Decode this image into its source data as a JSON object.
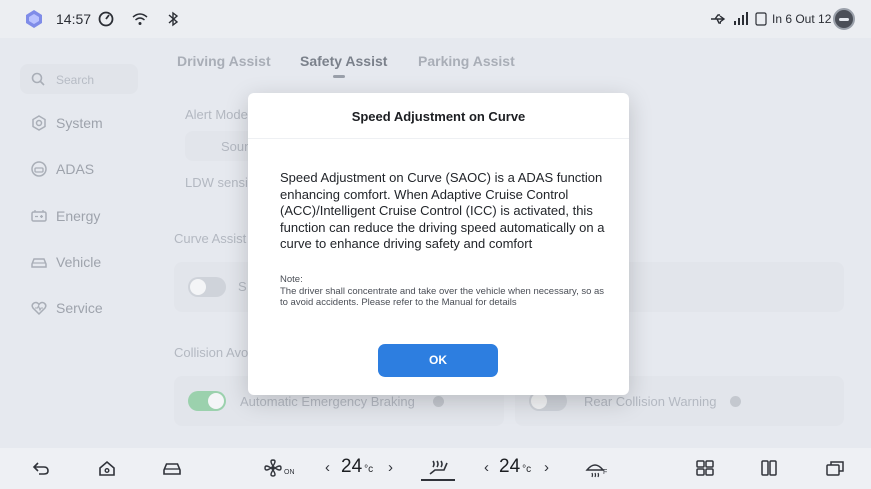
{
  "status_bar": {
    "time": "14:57",
    "right_text": "In 6 Out 12",
    "icons": [
      "app-logo-icon",
      "drive-mode-icon",
      "wifi-icon",
      "bluetooth-icon",
      "usb-icon",
      "cellular-signal-icon",
      "sim-icon",
      "avatar-icon"
    ]
  },
  "sidebar": {
    "search_placeholder": "Search",
    "items": [
      {
        "label": "System",
        "icon": "gear-icon"
      },
      {
        "label": "ADAS",
        "icon": "car-radar-icon"
      },
      {
        "label": "Energy",
        "icon": "battery-icon"
      },
      {
        "label": "Vehicle",
        "icon": "vehicle-icon"
      },
      {
        "label": "Service",
        "icon": "heart-icon"
      }
    ]
  },
  "tabs": [
    {
      "label": "Driving Assist",
      "active": false
    },
    {
      "label": "Safety Assist",
      "active": true
    },
    {
      "label": "Parking Assist",
      "active": false
    }
  ],
  "background": {
    "alert_mode_label": "Alert Mode",
    "sound_label": "Sound",
    "ldw_label": "LDW sensitivity",
    "curve_assist_label": "Curve Assist",
    "curve_item_label": "S",
    "collision_label": "Collision Avoidance",
    "aeb_label": "Automatic Emergency Braking",
    "rcw_label": "Rear Collision Warning"
  },
  "dialog": {
    "title": "Speed Adjustment on Curve",
    "body": "Speed Adjustment on Curve (SAOC) is a ADAS function enhancing comfort. When Adaptive Cruise Control (ACC)/Intelligent Cruise Control (ICC) is activated, this function can reduce the driving speed automatically on a curve to enhance driving safety and comfort",
    "note_title": "Note:",
    "note_text": "The driver shall concentrate and take over the vehicle when necessary, so as to avoid accidents. Please refer to the Manual for details",
    "ok_label": "OK"
  },
  "dock": {
    "left_temp": "24",
    "right_temp": "24",
    "temp_unit": "°c",
    "fan_status": "ON",
    "defrost_sub": "F",
    "icons": [
      "back-icon",
      "home-icon",
      "car-icon",
      "fan-icon",
      "seat-heat-icon",
      "defrost-icon",
      "apps-grid-icon",
      "split-screen-icon",
      "multi-window-icon"
    ]
  },
  "colors": {
    "accent": "#2d7ee0",
    "toggle_on": "#9bd1ad"
  }
}
